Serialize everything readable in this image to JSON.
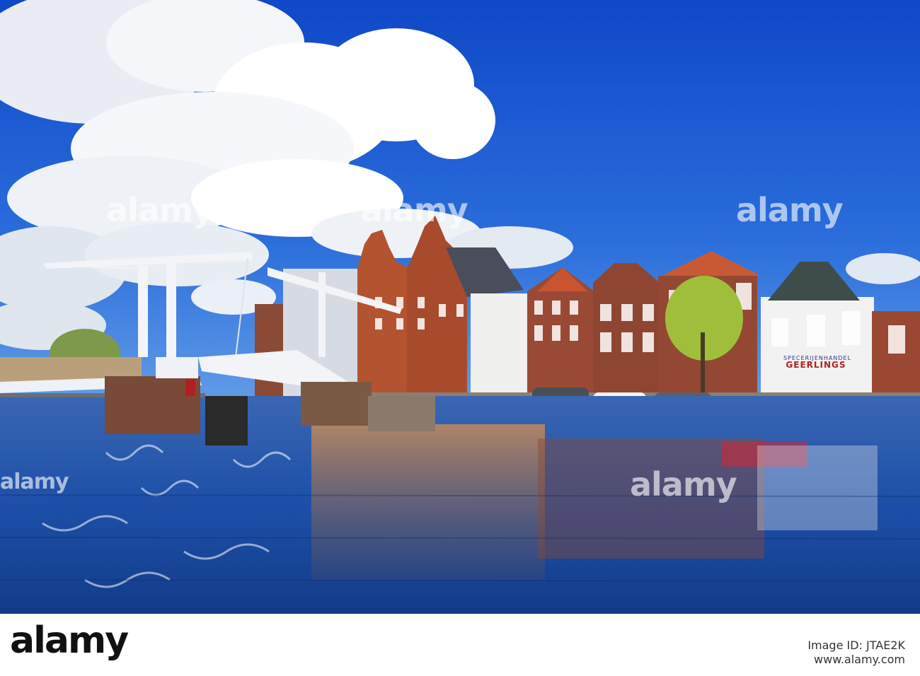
{
  "image": {
    "watermark_text": "alamy",
    "shop_sign_small": "SPECERIJENHANDEL",
    "shop_sign": "GEERLINGS",
    "footer": {
      "logo": "alamy",
      "image_id": "Image ID: JTAE2K",
      "site": "www.alamy.com"
    }
  },
  "colors": {
    "sky": "#1f5ed6",
    "water": "#1d4fa8",
    "brick": "#9b4a33",
    "bridge": "#f2f4f7",
    "car": "#d8252f"
  }
}
